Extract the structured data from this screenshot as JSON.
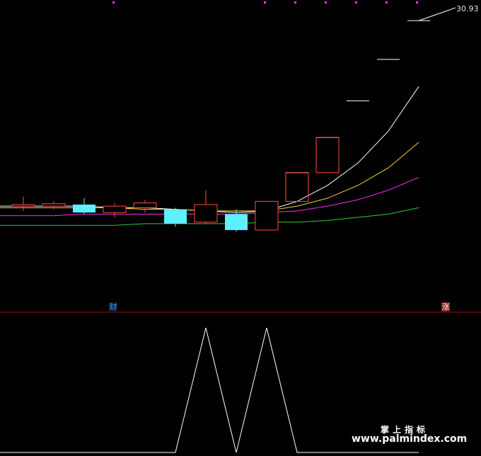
{
  "price_label": "30.93",
  "badges": {
    "left": "财",
    "right": "涨"
  },
  "watermark": {
    "title": "掌上指标",
    "url": "www.palmindex.com"
  },
  "colors": {
    "up": "#ff4a3a",
    "down": "#5ff0ff",
    "signal": "#ffffff",
    "ma_fast": "#ffffff",
    "ma_mid": "#ffcc33",
    "ma_slow": "#ee33ee",
    "ma_long": "#33cc33",
    "divider": "#8b1a1a",
    "dots": "#ff33ff"
  },
  "chart_data": {
    "type": "candlestick",
    "title": "",
    "ylim": [
      15,
      32
    ],
    "candles": [
      {
        "o": 19.3,
        "h": 19.9,
        "l": 19.0,
        "c": 19.4
      },
      {
        "o": 19.3,
        "h": 19.6,
        "l": 19.1,
        "c": 19.45
      },
      {
        "o": 19.4,
        "h": 19.8,
        "l": 18.8,
        "c": 18.9
      },
      {
        "o": 18.9,
        "h": 19.5,
        "l": 18.6,
        "c": 19.3
      },
      {
        "o": 19.2,
        "h": 19.7,
        "l": 18.9,
        "c": 19.5
      },
      {
        "o": 19.1,
        "h": 19.2,
        "l": 18.0,
        "c": 18.2
      },
      {
        "o": 18.3,
        "h": 20.3,
        "l": 18.2,
        "c": 19.4
      },
      {
        "o": 18.8,
        "h": 19.1,
        "l": 17.7,
        "c": 17.8
      },
      {
        "o": 17.8,
        "h": 19.6,
        "l": 17.8,
        "c": 19.6
      },
      {
        "o": 21.4,
        "h": 21.4,
        "l": 21.4,
        "c": 21.4
      },
      {
        "o": 23.6,
        "h": 23.6,
        "l": 23.6,
        "c": 23.6
      },
      {
        "o": 25.9,
        "h": 25.9,
        "l": 25.9,
        "c": 25.9
      },
      {
        "o": 28.5,
        "h": 28.5,
        "l": 28.5,
        "c": 28.5
      },
      {
        "o": 30.93,
        "h": 30.93,
        "l": 30.93,
        "c": 30.93
      }
    ],
    "boxed_limit_up": [
      9,
      10
    ],
    "moving_averages": [
      {
        "key": "ma_fast",
        "values": [
          19.3,
          19.3,
          19.3,
          19.2,
          19.2,
          19.1,
          19.0,
          18.9,
          19.0,
          19.6,
          20.6,
          22.0,
          24.0,
          26.8
        ]
      },
      {
        "key": "ma_mid",
        "values": [
          19.2,
          19.2,
          19.2,
          19.2,
          19.1,
          19.1,
          19.0,
          19.0,
          19.0,
          19.3,
          19.8,
          20.6,
          21.7,
          23.3
        ]
      },
      {
        "key": "ma_slow",
        "values": [
          18.7,
          18.7,
          18.8,
          18.8,
          18.8,
          18.8,
          18.8,
          18.8,
          18.9,
          19.0,
          19.3,
          19.7,
          20.3,
          21.1
        ]
      },
      {
        "key": "ma_long",
        "values": [
          18.1,
          18.1,
          18.1,
          18.1,
          18.2,
          18.2,
          18.2,
          18.2,
          18.3,
          18.3,
          18.4,
          18.6,
          18.8,
          19.2
        ]
      }
    ],
    "signal": {
      "type": "line",
      "ylim": [
        0,
        1
      ],
      "values": [
        0,
        0,
        0,
        0,
        0,
        0,
        1,
        0,
        1,
        0,
        0,
        0,
        0,
        0
      ]
    }
  }
}
